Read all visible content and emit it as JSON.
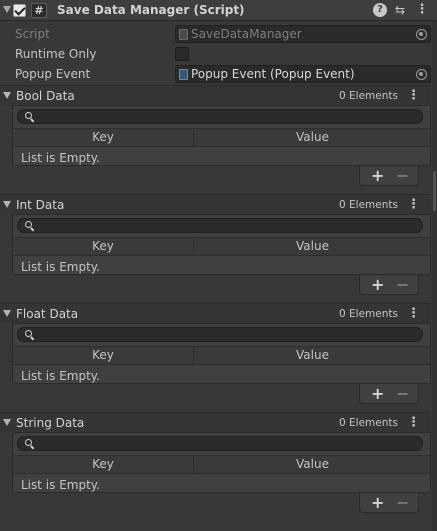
{
  "component": {
    "title": "Save Data Manager (Script)",
    "help_icon": "help-icon",
    "preset_icon": "preset-icon",
    "menu_icon": "kebab-menu-icon"
  },
  "fields": {
    "script_label": "Script",
    "script_value": "SaveDataManager",
    "runtime_only_label": "Runtime Only",
    "popup_event_label": "Popup Event",
    "popup_event_value": "Popup Event (Popup Event)"
  },
  "lists": [
    {
      "title": "Bool Data",
      "count": "0 Elements",
      "key_header": "Key",
      "value_header": "Value",
      "empty_text": "List is Empty.",
      "add": "+",
      "remove": "−"
    },
    {
      "title": "Int Data",
      "count": "0 Elements",
      "key_header": "Key",
      "value_header": "Value",
      "empty_text": "List is Empty.",
      "add": "+",
      "remove": "−"
    },
    {
      "title": "Float Data",
      "count": "0 Elements",
      "key_header": "Key",
      "value_header": "Value",
      "empty_text": "List is Empty.",
      "add": "+",
      "remove": "−"
    },
    {
      "title": "String Data",
      "count": "0 Elements",
      "key_header": "Key",
      "value_header": "Value",
      "empty_text": "List is Empty.",
      "add": "+",
      "remove": "−"
    }
  ],
  "colors": {
    "background": "#383838",
    "field": "#2a2a2a",
    "text": "#c4c4c4"
  }
}
